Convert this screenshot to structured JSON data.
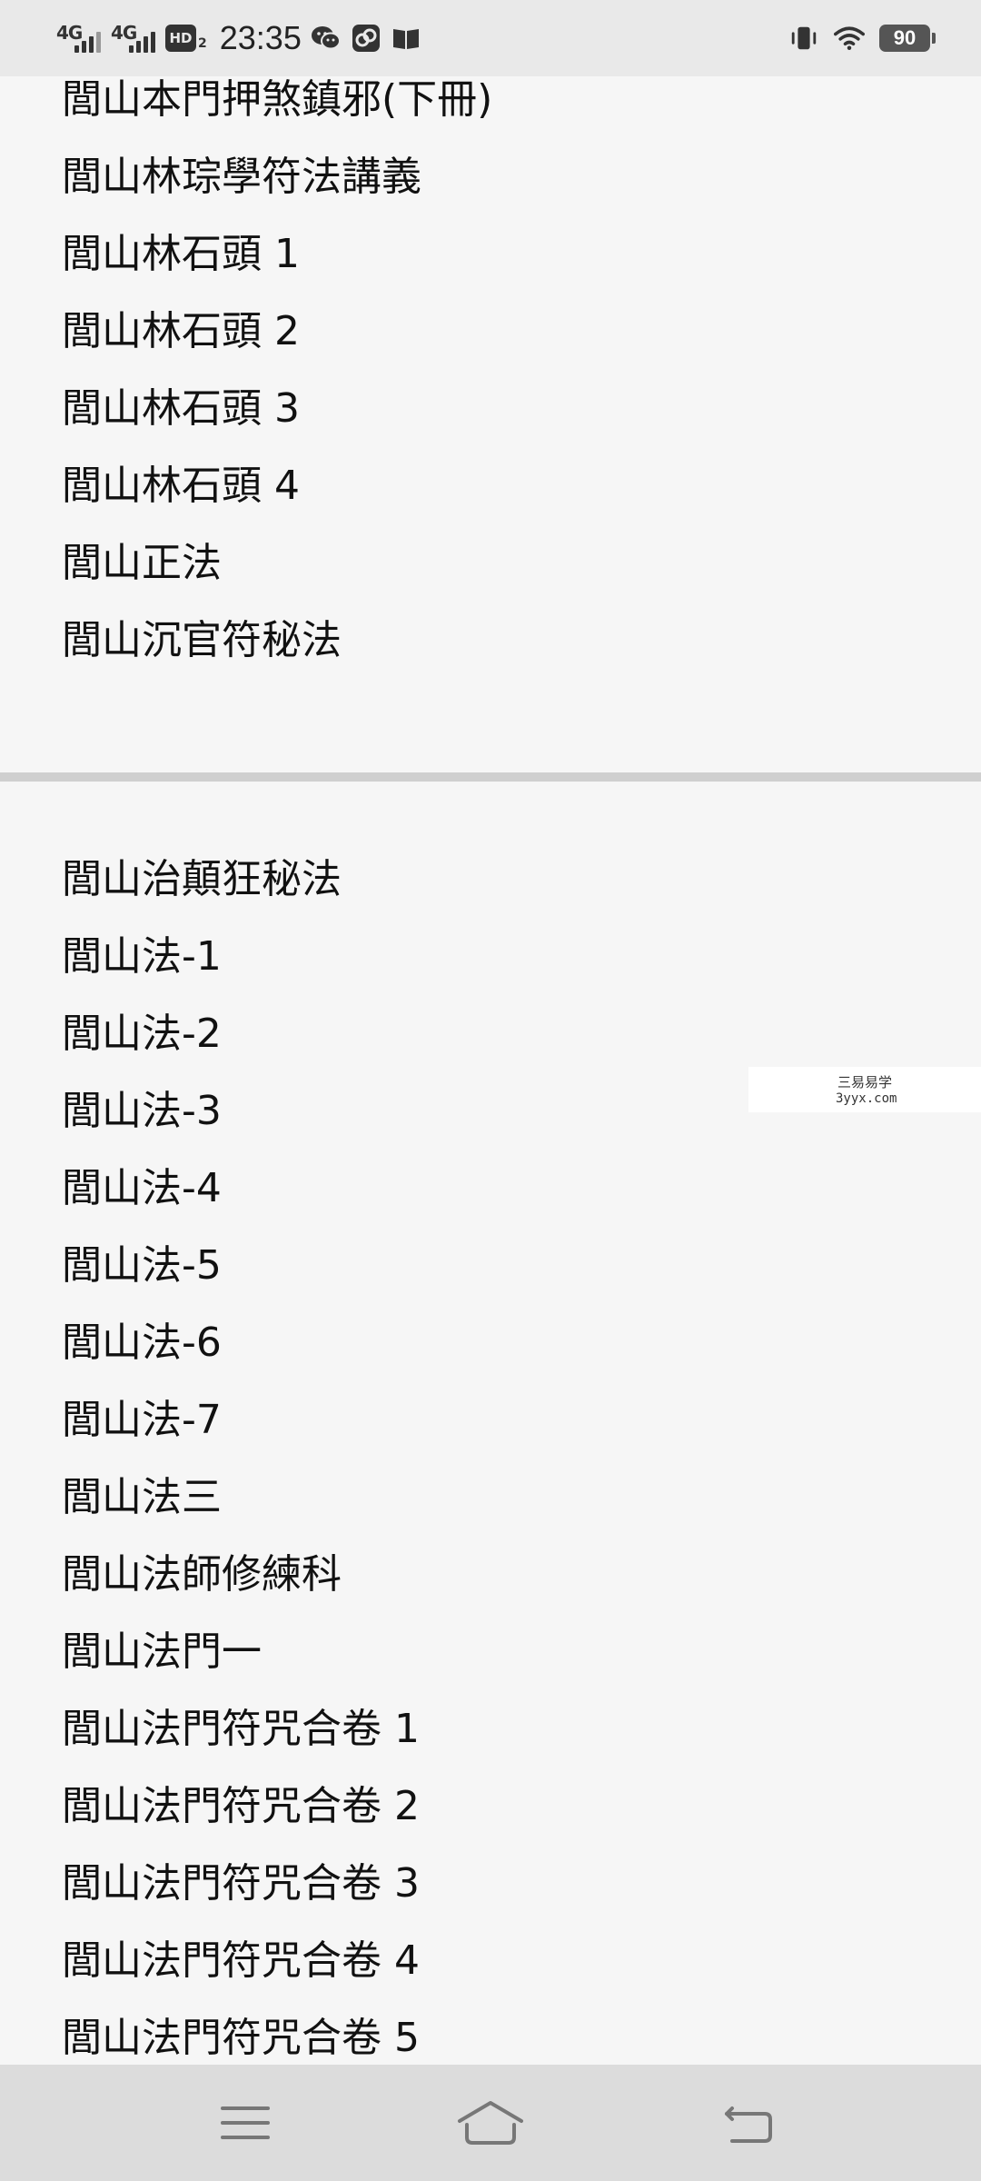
{
  "status_bar": {
    "signal1_label": "4G",
    "signal2_label": "4G",
    "hd_label": "HD",
    "hd_sub": "2",
    "time": "23:35",
    "battery": "90"
  },
  "list_top": [
    "閭山本門押煞鎮邪(下冊)",
    "閭山林琮學符法講義",
    "閭山林石頭 1",
    "閭山林石頭 2",
    "閭山林石頭 3",
    "閭山林石頭 4",
    "閭山正法",
    "閭山沉官符秘法"
  ],
  "list_bottom": [
    "閭山治顛狂秘法",
    "閭山法-1",
    "閭山法-2",
    "閭山法-3",
    "閭山法-4",
    "閭山法-5",
    "閭山法-6",
    "閭山法-7",
    "閭山法三",
    "閭山法師修練科",
    "閭山法門一",
    "閭山法門符咒合卷 1",
    "閭山法門符咒合卷 2",
    "閭山法門符咒合卷 3",
    "閭山法門符咒合卷 4",
    "閭山法門符咒合卷 5"
  ],
  "watermark": {
    "line1": "三易易学",
    "line2": "3yyx.com"
  },
  "nav_bar": {
    "menu_icon": "menu-icon",
    "home_icon": "home-icon",
    "back_icon": "back-icon"
  }
}
